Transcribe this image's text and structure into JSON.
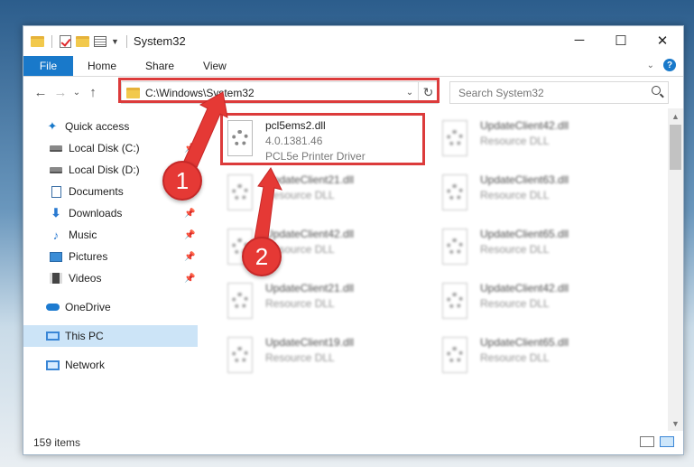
{
  "window": {
    "title": "System32",
    "controls": {
      "minimize": "─",
      "maximize": "☐",
      "close": "✕"
    }
  },
  "ribbon": {
    "tabs": [
      {
        "label": "File",
        "active": true
      },
      {
        "label": "Home"
      },
      {
        "label": "Share"
      },
      {
        "label": "View"
      }
    ],
    "help": "?",
    "expand": "⌄"
  },
  "address": {
    "path": "C:\\Windows\\System32",
    "dropdown": "⌄",
    "refresh": "↻"
  },
  "search": {
    "placeholder": "Search System32"
  },
  "nav": {
    "back": "←",
    "forward": "→",
    "recent": "⌄",
    "up": "↑",
    "items": [
      {
        "label": "Quick access",
        "icon": "star-icon",
        "top": true
      },
      {
        "label": "Local Disk (C:)",
        "icon": "drive-icon",
        "pinned": true
      },
      {
        "label": "Local Disk (D:)",
        "icon": "drive-icon"
      },
      {
        "label": "Documents",
        "icon": "document-icon"
      },
      {
        "label": "Downloads",
        "icon": "download-icon",
        "pinned": true
      },
      {
        "label": "Music",
        "icon": "music-icon",
        "pinned": true
      },
      {
        "label": "Pictures",
        "icon": "pictures-icon",
        "pinned": true
      },
      {
        "label": "Videos",
        "icon": "videos-icon",
        "pinned": true
      },
      {
        "label": "OneDrive",
        "icon": "onedrive-icon",
        "top": true
      },
      {
        "label": "This PC",
        "icon": "this-pc-icon",
        "top": true,
        "selected": true
      },
      {
        "label": "Network",
        "icon": "network-icon",
        "top": true
      }
    ]
  },
  "files": [
    {
      "name": "pcl5ems2.dll",
      "version": "4.0.1381.46",
      "type": "PCL5e Printer Driver",
      "highlighted": true
    },
    {
      "name": "UpdateClient42.dll",
      "type": "Resource DLL"
    },
    {
      "name": "UpdateClient21.dll",
      "type": "Resource DLL"
    },
    {
      "name": "UpdateClient63.dll",
      "type": "Resource DLL"
    },
    {
      "name": "UpdateClient42.dll",
      "type": "Resource DLL"
    },
    {
      "name": "UpdateClient65.dll",
      "type": "Resource DLL"
    },
    {
      "name": "UpdateClient21.dll",
      "type": "Resource DLL"
    },
    {
      "name": "UpdateClient42.dll",
      "type": "Resource DLL"
    },
    {
      "name": "UpdateClient19.dll",
      "type": "Resource DLL"
    },
    {
      "name": "UpdateClient65.dll",
      "type": "Resource DLL"
    }
  ],
  "status": {
    "items": "159 items"
  },
  "annotations": {
    "step1": "1",
    "step2": "2",
    "color": "#dc3b3b"
  }
}
